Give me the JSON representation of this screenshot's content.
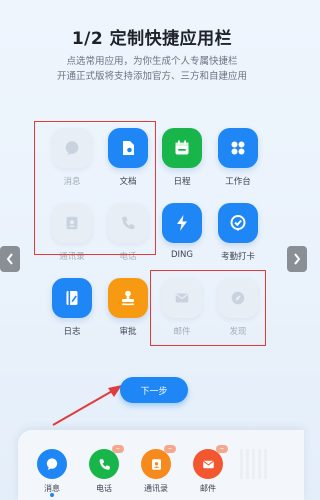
{
  "header": {
    "title": "1/2 定制快捷应用栏",
    "subtitle_line1": "点选常用应用，为你生成个人专属快捷栏",
    "subtitle_line2": "开通正式版将支持添加官方、三方和自建应用"
  },
  "apps": [
    {
      "id": "messages",
      "label": "消息",
      "icon": "chat-bubble-icon",
      "enabled": false,
      "color": "#e8eef5"
    },
    {
      "id": "docs",
      "label": "文档",
      "icon": "document-icon",
      "enabled": true,
      "color": "#1e86f5"
    },
    {
      "id": "calendar",
      "label": "日程",
      "icon": "calendar-icon",
      "enabled": true,
      "color": "#18b54a"
    },
    {
      "id": "workbench",
      "label": "工作台",
      "icon": "grid-icon",
      "enabled": true,
      "color": "#1e86f5"
    },
    {
      "id": "contacts",
      "label": "通讯录",
      "icon": "contacts-icon",
      "enabled": false,
      "color": "#e8eef5"
    },
    {
      "id": "phone",
      "label": "电话",
      "icon": "phone-icon",
      "enabled": false,
      "color": "#e8eef5"
    },
    {
      "id": "ding",
      "label": "DING",
      "icon": "lightning-icon",
      "enabled": true,
      "color": "#1e86f5"
    },
    {
      "id": "attendance",
      "label": "考勤打卡",
      "icon": "check-shield-icon",
      "enabled": true,
      "color": "#1e86f5"
    },
    {
      "id": "log",
      "label": "日志",
      "icon": "notebook-icon",
      "enabled": true,
      "color": "#1e86f5"
    },
    {
      "id": "approval",
      "label": "审批",
      "icon": "stamp-icon",
      "enabled": true,
      "color": "#f79a12"
    },
    {
      "id": "mail",
      "label": "邮件",
      "icon": "mail-icon",
      "enabled": false,
      "color": "#e8eef5"
    },
    {
      "id": "discover",
      "label": "发现",
      "icon": "compass-icon",
      "enabled": false,
      "color": "#e8eef5"
    }
  ],
  "next_button": {
    "label": "下一步"
  },
  "dock": {
    "items": [
      {
        "label": "消息",
        "icon": "chat-bubble-icon",
        "color": "#1e86f5",
        "removable": false
      },
      {
        "label": "电话",
        "icon": "phone-icon",
        "color": "#18b54a",
        "removable": true
      },
      {
        "label": "通讯录",
        "icon": "contacts-icon",
        "color": "#f78a1d",
        "removable": true
      },
      {
        "label": "邮件",
        "icon": "mail-icon",
        "color": "#f3572f",
        "removable": true
      }
    ]
  },
  "nav": {
    "prev_icon": "chevron-left-icon",
    "next_icon": "chevron-right-icon"
  },
  "colors": {
    "accent": "#1e86f5",
    "highlight_border": "#e23b3b"
  }
}
